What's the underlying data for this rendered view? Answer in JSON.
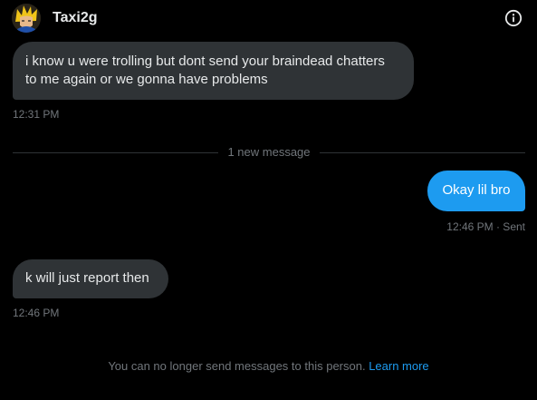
{
  "header": {
    "username": "Taxi2g",
    "avatar_icon": "user-avatar",
    "info_icon": "info-circle-icon"
  },
  "messages": [
    {
      "direction": "received",
      "lines": [
        "i know u were trolling but dont send your braindead chatters",
        "to me again or we gonna have problems"
      ],
      "timestamp": "12:31 PM"
    },
    {
      "direction": "sent",
      "text": "Okay lil bro",
      "timestamp": "12:46 PM · Sent"
    },
    {
      "direction": "received",
      "text": "k will just report then",
      "timestamp": "12:46 PM"
    }
  ],
  "divider": {
    "label": "1 new message"
  },
  "footer": {
    "notice": "You can no longer send messages to this person. ",
    "link": "Learn more"
  },
  "colors": {
    "background": "#000000",
    "received_bubble": "#2f3336",
    "sent_bubble": "#1d9bf0",
    "muted_text": "#71767b",
    "link": "#1d9bf0"
  }
}
